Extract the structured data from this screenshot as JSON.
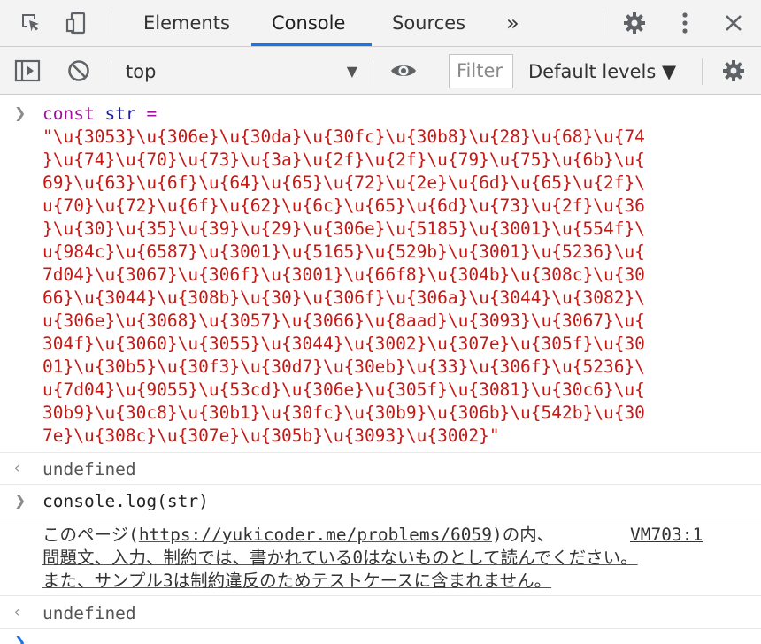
{
  "tabs": {
    "items": [
      "Elements",
      "Console",
      "Sources"
    ],
    "more_label": "»",
    "active": "Console"
  },
  "toolbar": {
    "context_label": "top",
    "filter_placeholder": "Filter",
    "levels_label": "Default levels ▼"
  },
  "console": {
    "entry1": {
      "line1": {
        "kw": "const",
        "var": "str",
        "op": "="
      },
      "string_lines": [
        "\"\\u{3053}\\u{306e}\\u{30da}\\u{30fc}\\u{30b8}\\u{28}\\u{68}\\u{74",
        "}\\u{74}\\u{70}\\u{73}\\u{3a}\\u{2f}\\u{2f}\\u{79}\\u{75}\\u{6b}\\u{",
        "69}\\u{63}\\u{6f}\\u{64}\\u{65}\\u{72}\\u{2e}\\u{6d}\\u{65}\\u{2f}\\",
        "u{70}\\u{72}\\u{6f}\\u{62}\\u{6c}\\u{65}\\u{6d}\\u{73}\\u{2f}\\u{36",
        "}\\u{30}\\u{35}\\u{39}\\u{29}\\u{306e}\\u{5185}\\u{3001}\\u{554f}\\",
        "u{984c}\\u{6587}\\u{3001}\\u{5165}\\u{529b}\\u{3001}\\u{5236}\\u{",
        "7d04}\\u{3067}\\u{306f}\\u{3001}\\u{66f8}\\u{304b}\\u{308c}\\u{30",
        "66}\\u{3044}\\u{308b}\\u{30}\\u{306f}\\u{306a}\\u{3044}\\u{3082}\\",
        "u{306e}\\u{3068}\\u{3057}\\u{3066}\\u{8aad}\\u{3093}\\u{3067}\\u{",
        "304f}\\u{3060}\\u{3055}\\u{3044}\\u{3002}\\u{307e}\\u{305f}\\u{30",
        "01}\\u{30b5}\\u{30f3}\\u{30d7}\\u{30eb}\\u{33}\\u{306f}\\u{5236}\\",
        "u{7d04}\\u{9055}\\u{53cd}\\u{306e}\\u{305f}\\u{3081}\\u{30c6}\\u{",
        "30b9}\\u{30c8}\\u{30b1}\\u{30fc}\\u{30b9}\\u{306b}\\u{542b}\\u{30",
        "7e}\\u{308c}\\u{307e}\\u{305b}\\u{3093}\\u{3002}\""
      ]
    },
    "result1": "undefined",
    "entry2": "console.log(str)",
    "log": {
      "line1_prefix": "このページ(",
      "line1_link": "https://yukicoder.me/problems/6059",
      "line1_suffix": ")の内、",
      "line2": "問題文、入力、制約では、書かれている0はないものとして読んでください。",
      "line3": "また、サンプル3は制約違反のためテストケースに含まれません。",
      "source": "VM703:1"
    },
    "result2": "undefined"
  }
}
